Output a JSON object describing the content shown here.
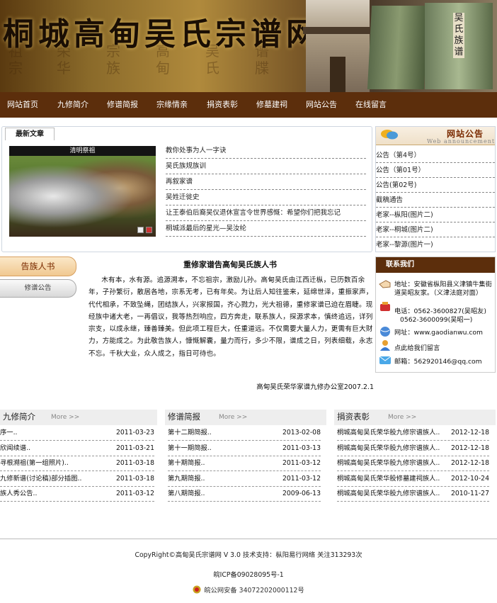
{
  "banner": {
    "title": "桐城高甸吴氏宗谱网",
    "seal_cols": [
      "祖\n宗",
      "荣\n华",
      "宗\n族",
      "高\n甸",
      "吴\n氏",
      "谱\n牒"
    ],
    "book_label": "吴氏族谱"
  },
  "nav": {
    "items": [
      "网站首页",
      "九修简介",
      "修谱简报",
      "宗缘情亲",
      "捐资表彰",
      "修墓建祠",
      "网站公告",
      "在线留言"
    ]
  },
  "latest": {
    "tab_label": "最新文章",
    "photo_caption": "清明祭祖",
    "items": [
      "教你处事为人一字诀",
      "吴氏族规族训",
      "再叙家谱",
      "吴姓迁徙史",
      "让王泰伯后裔吴仪退休宣言令世界感慨：希望你们把我忘记",
      "桐城派最后的星光—吴汝纶"
    ]
  },
  "announcement": {
    "title": "网站公告",
    "subtitle": "Web announcement",
    "items": [
      "公告（第4号）",
      "公告（第01号）",
      "公告(第02号)",
      "截稿通告",
      "老家--枞阳(图片二)",
      "老家--桐城(图片二)",
      "老家--黎源(图片一)"
    ]
  },
  "clan_tab": {
    "title": "告族人书",
    "notice_button": "修谱公告"
  },
  "article": {
    "title": "重修家谱告高甸吴氏族人书",
    "body": "木有本，水有源。追源溯本，不忘祖宗，激励儿孙。高甸吴氏由江西迁枞，已历数百余年，子孙繁衍，散居各地，宗系无考，已有年矣。为让后人知往鉴来，延绵世泽，重振家声，代代相承，不致坠绳，团结族人，兴家报国，齐心戮力，光大祖德，重修家谱已迫在眉睫。现经族中诸大老，一再倡议，我等热烈响应，四方奔走，联系族人，探源求本，慎终追远，详列宗支，以成永继，臻善臻美。但此项工程巨大，任重道远。不仅需要大量人力，更需有巨大财力，方能成之。为此敬告族人，慷慨解囊，量力而行，多少不限，谱成之日，列表细载，永志不忘。千秋大业，众人成之，指日可待也。",
    "signature": "高甸吴氏荣华家谱九修办公室2007.2.1"
  },
  "contact": {
    "title": "联系我们",
    "address": "地址：安徽省枞阳县义津镇牛集街道吴昭友家。（义津法庭对面）",
    "phone1": "电话：0562-3600827(吴昭友)",
    "phone2": "0562-3600099(吴昭一)",
    "website": "网址：www.gaodianwu.com",
    "message": "点此给我们留言",
    "email": "邮箱：562920146@qq.com"
  },
  "columns": [
    {
      "title": "九修简介",
      "more": "More >>",
      "rows": [
        {
          "text": "序一..",
          "date": "2011-03-23"
        },
        {
          "text": "欣闻续谱..",
          "date": "2011-03-21"
        },
        {
          "text": "寻根溯祖(第一组照片)..",
          "date": "2011-03-18"
        },
        {
          "text": "九修新谱(讨论稿)部分插图..",
          "date": "2011-03-18"
        },
        {
          "text": "族人秀公告..",
          "date": "2011-03-12"
        }
      ]
    },
    {
      "title": "修谱简报",
      "more": "More >>",
      "rows": [
        {
          "text": "第十二期简报..",
          "date": "2013-02-08"
        },
        {
          "text": "第十一期简报..",
          "date": "2011-03-13"
        },
        {
          "text": "第十期简报..",
          "date": "2011-03-12"
        },
        {
          "text": "第九期简报..",
          "date": "2011-03-12"
        },
        {
          "text": "第八期简报..",
          "date": "2009-06-13"
        }
      ]
    },
    {
      "title": "捐资表彰",
      "more": "More >>",
      "rows": [
        {
          "text": "桐城高甸吴氏荣华股九修宗谱族人..",
          "date": "2012-12-18"
        },
        {
          "text": "桐城高甸吴氏荣华股九修宗谱族人..",
          "date": "2012-12-18"
        },
        {
          "text": "桐城高甸吴氏荣华股九修宗谱族人..",
          "date": "2012-12-18"
        },
        {
          "text": "桐城高甸吴氏荣华股修墓建祠族人..",
          "date": "2012-10-24"
        },
        {
          "text": "桐城高甸吴氏荣华股九修宗谱族人..",
          "date": "2010-11-27"
        }
      ]
    }
  ],
  "footer": {
    "copyright": "CopyRight©高甸吴氏宗谱网 V 3.0    技术支持：枞阳易行网络 关注313293次",
    "icp": "皖ICP备09028095号-1",
    "police": "皖公网安备 34072202000112号"
  }
}
